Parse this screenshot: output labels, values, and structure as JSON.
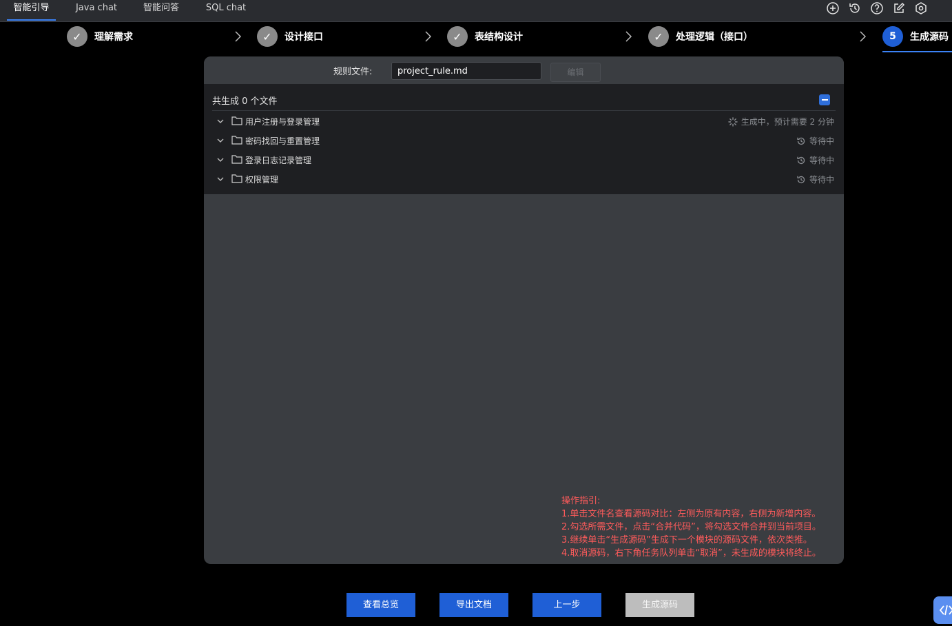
{
  "tabs": [
    {
      "label": "智能引导",
      "active": true
    },
    {
      "label": "Java chat",
      "active": false
    },
    {
      "label": "智能问答",
      "active": false
    },
    {
      "label": "SQL chat",
      "active": false
    }
  ],
  "toolbar_icons": [
    "add-circle-icon",
    "history-icon",
    "help-icon",
    "edit-icon",
    "settings-icon"
  ],
  "steps": [
    {
      "label": "理解需求",
      "state": "done",
      "mark": "✓"
    },
    {
      "label": "设计接口",
      "state": "done",
      "mark": "✓"
    },
    {
      "label": "表结构设计",
      "state": "done",
      "mark": "✓"
    },
    {
      "label": "处理逻辑（接口）",
      "state": "done",
      "mark": "✓"
    },
    {
      "label": "生成源码",
      "state": "current",
      "mark": "5"
    }
  ],
  "rule": {
    "label": "规则文件:",
    "value": "project_rule.md",
    "edit_label": "编辑"
  },
  "files": {
    "summary": "共生成 0 个文件",
    "rows": [
      {
        "name": "用户注册与登录管理",
        "status": "生成中，预计需要 2 分钟",
        "status_icon": "loading-spinner-icon"
      },
      {
        "name": "密码找回与重置管理",
        "status": "等待中",
        "status_icon": "history-icon"
      },
      {
        "name": "登录日志记录管理",
        "status": "等待中",
        "status_icon": "history-icon"
      },
      {
        "name": "权限管理",
        "status": "等待中",
        "status_icon": "history-icon"
      }
    ]
  },
  "guide": {
    "title": "操作指引:",
    "lines": [
      "1.单击文件名查看源码对比：左侧为原有内容，右侧为新增内容。",
      "2.勾选所需文件，点击“合并代码”，将勾选文件合并到当前项目。",
      "3.继续单击“生成源码”生成下一个模块的源码文件，依次类推。",
      "4.取消源码，右下角任务队列单击“取消”，未生成的模块将终止。"
    ]
  },
  "buttons": {
    "overview": "查看总览",
    "export": "导出文档",
    "prev": "上一步",
    "generate": "生成源码"
  },
  "colors": {
    "accent": "#1f5fd6",
    "guide_text": "#ff5b5b",
    "done_step": "#8a8a8a"
  }
}
